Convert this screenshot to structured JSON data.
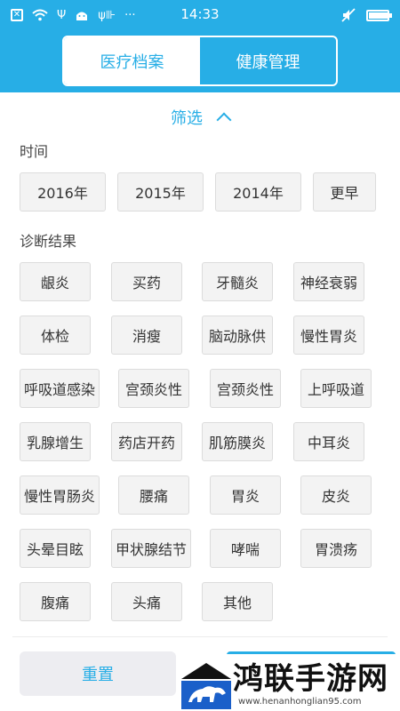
{
  "status_bar": {
    "time": "14:33",
    "left_icons": [
      "close-box-icon",
      "wifi-icon",
      "usb-icon",
      "android-icon",
      "signal-speed-icon",
      "more-icon"
    ],
    "right_icons": [
      "mute-icon"
    ],
    "battery_level": 0.95
  },
  "header": {
    "tabs": [
      {
        "label": "医疗档案",
        "active": true
      },
      {
        "label": "健康管理",
        "active": false
      }
    ]
  },
  "filter": {
    "label": "筛选"
  },
  "time_section": {
    "label": "时间",
    "options": [
      "2016年",
      "2015年",
      "2014年",
      "更早"
    ]
  },
  "diagnosis_section": {
    "label": "诊断结果",
    "options": [
      "龈炎",
      "买药",
      "牙髓炎",
      "神经衰弱",
      "体检",
      "消瘦",
      "脑动脉供",
      "慢性胃炎",
      "呼吸道感染",
      "宫颈炎性",
      "宫颈炎性",
      "上呼吸道",
      "乳腺增生",
      "药店开药",
      "肌筋膜炎",
      "中耳炎",
      "慢性胃肠炎",
      "腰痛",
      "胃炎",
      "皮炎",
      "头晕目眩",
      "甲状腺结节",
      "哮喘",
      "胃溃疡",
      "腹痛",
      "头痛",
      "其他"
    ]
  },
  "footer": {
    "reset_label": "重置"
  },
  "watermark": {
    "title": "鸿联手游网",
    "url": "www.henanhonglian95.com"
  },
  "colors": {
    "accent": "#27aee6",
    "chip_bg": "#f3f3f3",
    "reset_bg": "#ededf1"
  }
}
